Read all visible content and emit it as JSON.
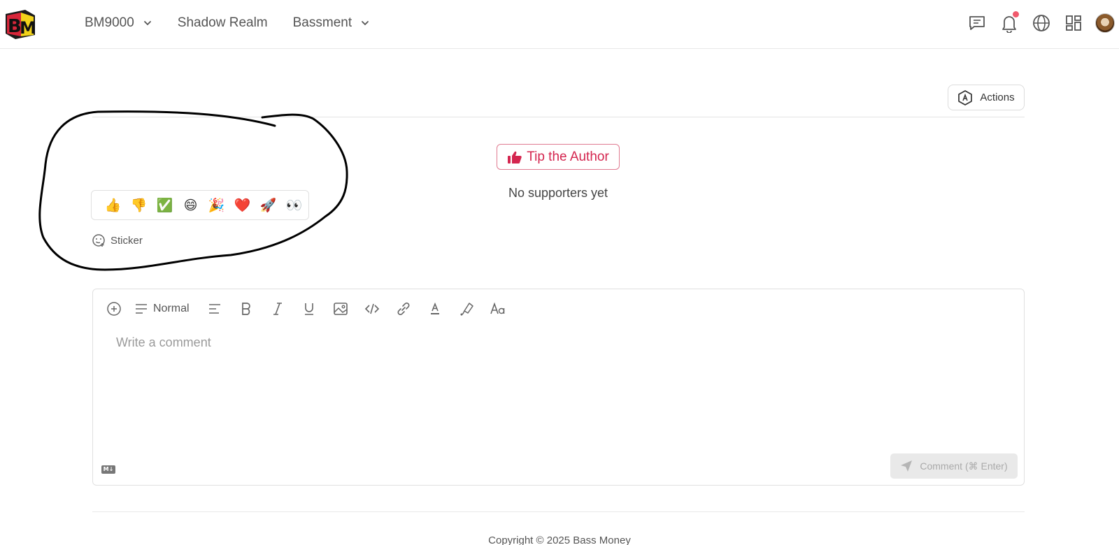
{
  "header": {
    "logo_text": "BM",
    "nav": [
      {
        "label": "BM9000",
        "has_dropdown": true
      },
      {
        "label": "Shadow Realm",
        "has_dropdown": false
      },
      {
        "label": "Bassment",
        "has_dropdown": true
      }
    ],
    "icons": [
      "messages-icon",
      "bell-icon",
      "globe-icon",
      "apps-grid-icon",
      "avatar"
    ],
    "notification_dot_color": "#f05a6c"
  },
  "actions": {
    "label": "Actions",
    "icon": "hexagon-a-icon"
  },
  "tip": {
    "label": "Tip the Author",
    "icon": "thumbs-up-icon",
    "color": "#d4264f"
  },
  "supporters_text": "No supporters yet",
  "reactions": [
    "👍",
    "👎",
    "✅",
    "😄",
    "🎉",
    "❤️",
    "🚀",
    "👀"
  ],
  "sticker_label": "Sticker",
  "editor": {
    "toolbar": {
      "insert": "plus-circle-icon",
      "text_style": "Normal",
      "tools": [
        "align-left-icon",
        "bold-icon",
        "italic-icon",
        "underline-icon",
        "image-icon",
        "code-icon",
        "link-icon",
        "text-color-icon",
        "highlight-icon",
        "font-size-icon"
      ]
    },
    "placeholder": "Write a comment",
    "markdown_badge": "M↓",
    "submit_label": "Comment (⌘ Enter)"
  },
  "footer": {
    "copyright": "Copyright © 2025 Bass Money"
  }
}
